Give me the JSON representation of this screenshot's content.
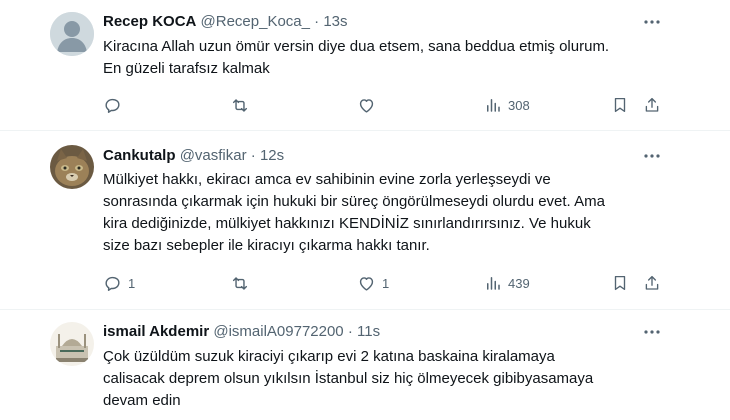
{
  "tweets": [
    {
      "name": "Recep KOCA",
      "handle": "@Recep_Koca_",
      "dot": "·",
      "time": "13s",
      "text": "Kiracına Allah uzun ömür versin diye dua etsem, sana beddua etmiş olurum.\nEn güzeli tarafsız kalmak",
      "replies": "",
      "likes": "",
      "views": "308"
    },
    {
      "name": "Cankutalp",
      "handle": "@vasfikar",
      "dot": "·",
      "time": "12s",
      "text": "Mülkiyet hakkı, ekiracı amca ev sahibinin evine zorla yerleşseydi ve\nsonrasında çıkarmak için hukuki bir süreç öngörülmeseydi olurdu evet. Ama\nkira dediğinizde, mülkiyet hakkınızı KENDİNİZ sınırlandırırsınız. Ve hukuk\nsize  bazı sebepler ile kiracıyı çıkarma hakkı tanır.",
      "replies": "1",
      "likes": "1",
      "views": "439"
    },
    {
      "name": "ismail Akdemir",
      "handle": "@ismailA09772200",
      "dot": "·",
      "time": "11s",
      "text": "Çok üzüldüm suzuk kiraciyi çıkarıp evi 2 katına baskaina kiralamaya\ncalisacak deprem olsun yıkılsın İstanbul siz hiç ölmeyecek gibibyasamaya\ndevam edin"
    }
  ],
  "colors": {
    "text": "#0f1419",
    "secondary": "#536471",
    "border": "#eff3f4"
  }
}
